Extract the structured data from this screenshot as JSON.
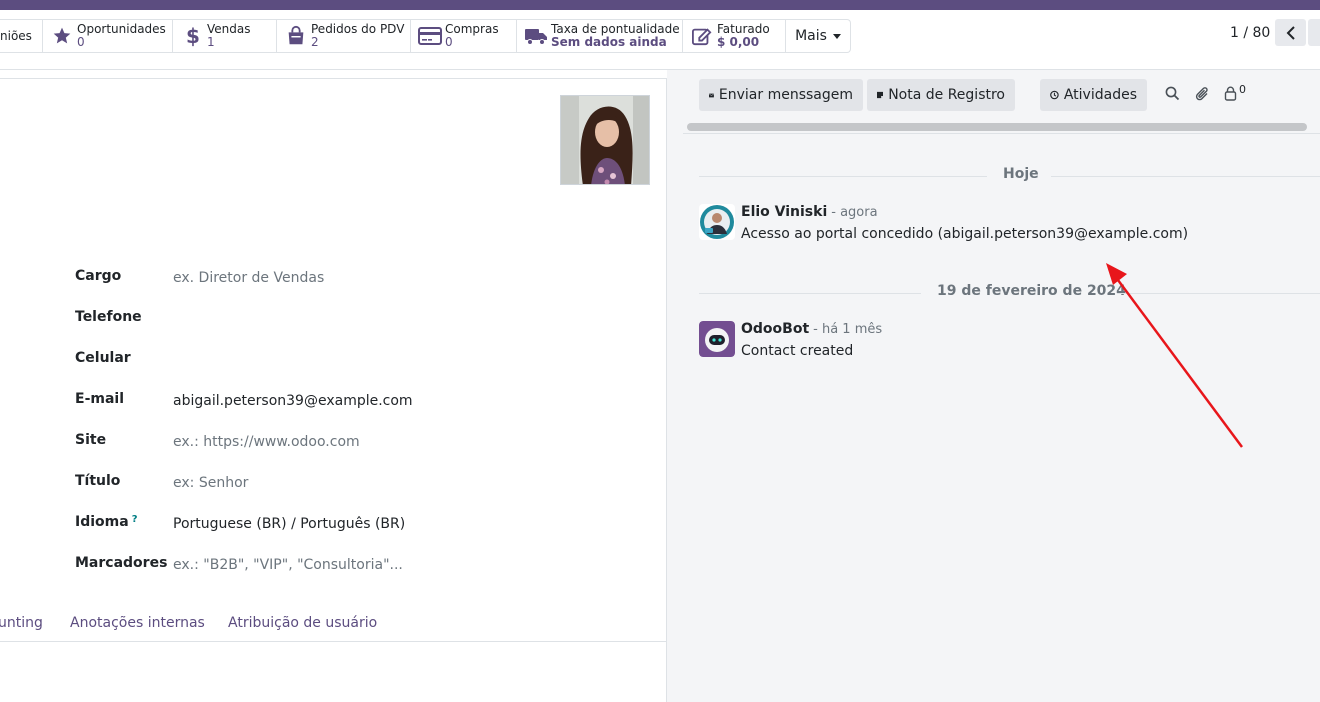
{
  "statbuttons": [
    {
      "label": "niões",
      "value": "",
      "icon": "none"
    },
    {
      "label": "Oportunidades",
      "value": "0",
      "icon": "star-icon"
    },
    {
      "label": "Vendas",
      "value": "1",
      "icon": "dollar-icon"
    },
    {
      "label": "Pedidos do PDV",
      "value": "2",
      "icon": "shopping-bag-icon"
    },
    {
      "label": "Compras",
      "value": "0",
      "icon": "credit-card-icon"
    },
    {
      "label": "Taxa de pontualidade",
      "value": "Sem dados ainda",
      "icon": "truck-icon"
    },
    {
      "label": "Faturado",
      "value": "$ 0,00",
      "icon": "edit-invoice-icon"
    }
  ],
  "more_label": "Mais",
  "pager": {
    "text": "1 / 80"
  },
  "form": {
    "fields": [
      {
        "label": "Cargo",
        "value": "ex. Diretor de Vendas",
        "placeholder": true
      },
      {
        "label": "Telefone",
        "value": "",
        "placeholder": false
      },
      {
        "label": "Celular",
        "value": "",
        "placeholder": false
      },
      {
        "label": "E-mail",
        "value": "abigail.peterson39@example.com",
        "placeholder": false
      },
      {
        "label": "Site",
        "value": "ex.: https://www.odoo.com",
        "placeholder": true
      },
      {
        "label": "Título",
        "value": "ex: Senhor",
        "placeholder": true
      },
      {
        "label": "Idioma",
        "value": "Portuguese (BR) / Português (BR)",
        "placeholder": false,
        "help": "?"
      },
      {
        "label": "Marcadores",
        "value": "ex.: \"B2B\", \"VIP\", \"Consultoria\"...",
        "placeholder": true
      }
    ],
    "tabs": [
      "unting",
      "Anotações internas",
      "Atribuição de usuário"
    ]
  },
  "chatter": {
    "send_message": "Enviar menssagem",
    "log_note": "Nota de Registro",
    "activities": "Atividades",
    "followers_count": "0",
    "date_today": "Hoje",
    "date_older": "19 de fevereiro de 2024",
    "messages": [
      {
        "author": "Elio Viniski",
        "time": "- agora",
        "body": "Acesso ao portal concedido (abigail.peterson39@example.com)"
      },
      {
        "author": "OdooBot",
        "time": "- há 1 mês",
        "body": "Contact created"
      }
    ]
  },
  "colors": {
    "brand": "#5c4d80",
    "annotation_arrow": "#e8161b"
  }
}
